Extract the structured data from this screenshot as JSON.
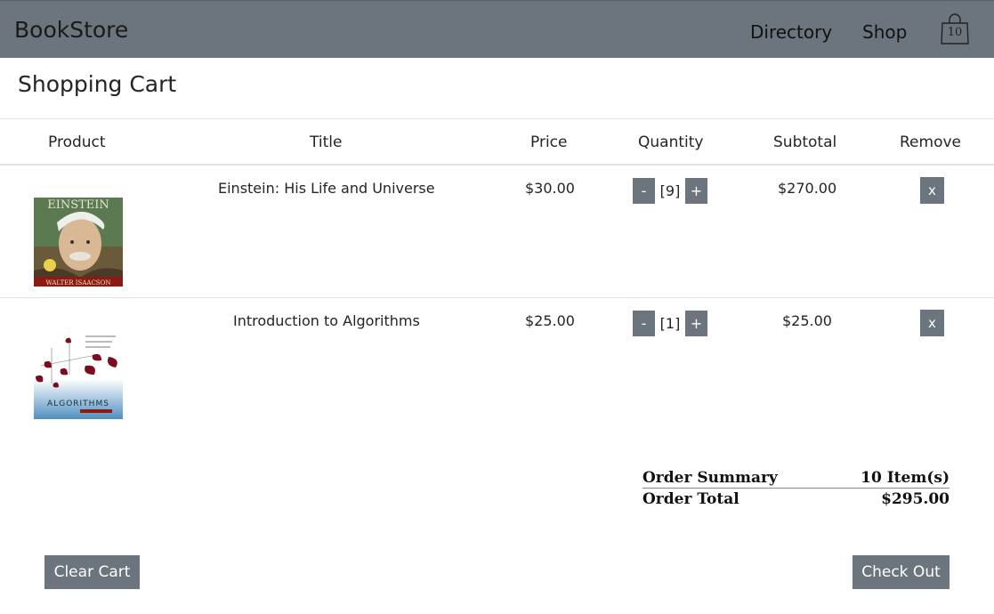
{
  "navbar": {
    "brand": "BookStore",
    "links": [
      "Directory",
      "Shop"
    ],
    "cart_icon": "shopping-bag-icon",
    "cart_count": "10",
    "background": "#6c757d"
  },
  "page": {
    "title": "Shopping Cart"
  },
  "table": {
    "headers": [
      "Product",
      "Title",
      "Price",
      "Quantity",
      "Subtotal",
      "Remove"
    ],
    "rows": [
      {
        "title": "Einstein: His Life and Universe",
        "price": "$30.00",
        "quantity": "[9]",
        "subtotal": "$270.00",
        "cover_text_top": "EINSTEIN",
        "cover_text_bottom": "WALTER ISAACSON"
      },
      {
        "title": "Introduction to Algorithms",
        "price": "$25.00",
        "quantity": "[1]",
        "subtotal": "$25.00",
        "cover_text": "ALGORITHMS"
      }
    ],
    "decrement_label": "-",
    "increment_label": "+",
    "remove_label": "x"
  },
  "summary": {
    "label": "Order Summary",
    "items": "10 Item(s)",
    "total_label": "Order Total",
    "total": "$295.00"
  },
  "actions": {
    "clear": "Clear Cart",
    "checkout": "Check Out"
  }
}
